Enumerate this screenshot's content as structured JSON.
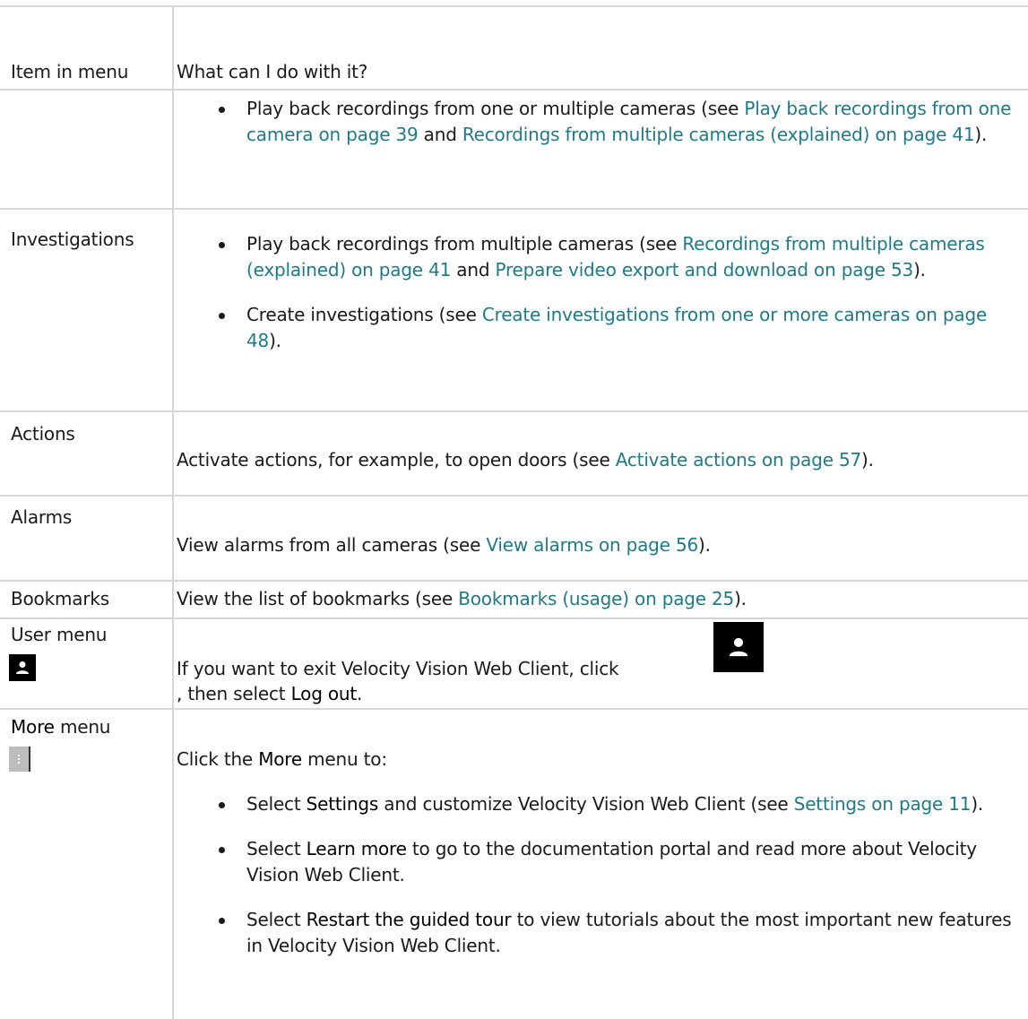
{
  "table": {
    "header": {
      "col1": "Item in menu",
      "col2": "What can I do with it?"
    },
    "rows": [
      {
        "label": "",
        "bullets": [
          [
            {
              "t": "Play back recordings from one or multiple cameras (see ",
              "k": "text"
            },
            {
              "t": "Play back recordings from one camera on page 39",
              "k": "link"
            },
            {
              "t": " and ",
              "k": "text"
            },
            {
              "t": "Recordings from multiple cameras (explained) on page 41",
              "k": "link"
            },
            {
              "t": ").",
              "k": "text"
            }
          ]
        ]
      },
      {
        "label": "Investigations",
        "bullets": [
          [
            {
              "t": "Play back recordings from multiple cameras (see ",
              "k": "text"
            },
            {
              "t": "Recordings from multiple cameras (explained) on page 41",
              "k": "link"
            },
            {
              "t": " and ",
              "k": "text"
            },
            {
              "t": "Prepare video export and download on page 53",
              "k": "link"
            },
            {
              "t": ").",
              "k": "text"
            }
          ],
          [
            {
              "t": "Create investigations (see ",
              "k": "text"
            },
            {
              "t": "Create investigations from one or more cameras on page 48",
              "k": "link"
            },
            {
              "t": ").",
              "k": "text"
            }
          ]
        ]
      },
      {
        "label": "Actions",
        "desc": [
          {
            "t": "Activate actions, for example, to open doors (see ",
            "k": "text"
          },
          {
            "t": "Activate actions on page 57",
            "k": "link"
          },
          {
            "t": ").",
            "k": "text"
          }
        ]
      },
      {
        "label": "Alarms",
        "desc": [
          {
            "t": "View alarms from all cameras (see ",
            "k": "text"
          },
          {
            "t": "View alarms on page 56",
            "k": "link"
          },
          {
            "t": ").",
            "k": "text"
          }
        ]
      },
      {
        "label": "Bookmarks",
        "desc": [
          {
            "t": "View the list of bookmarks (see ",
            "k": "text"
          },
          {
            "t": "Bookmarks (usage) on page 25",
            "k": "link"
          },
          {
            "t": ").",
            "k": "text"
          }
        ]
      },
      {
        "label": "User menu",
        "line1": "If you want to exit Velocity Vision Web Client, click ",
        "line2_pre": ", then select ",
        "line2_strong": "Log out",
        "line2_post": "."
      },
      {
        "label_strong": "More",
        "label_rest": " menu",
        "intro": [
          {
            "t": "Click the ",
            "k": "text"
          },
          {
            "t": "More",
            "k": "strong"
          },
          {
            "t": " menu to:",
            "k": "text"
          }
        ],
        "bullets": [
          [
            {
              "t": "Select ",
              "k": "text"
            },
            {
              "t": "Settings",
              "k": "strong"
            },
            {
              "t": " and customize Velocity Vision Web Client (see ",
              "k": "text"
            },
            {
              "t": "Settings on page 11",
              "k": "link"
            },
            {
              "t": ").",
              "k": "text"
            }
          ],
          [
            {
              "t": "Select ",
              "k": "text"
            },
            {
              "t": "Learn more",
              "k": "strong"
            },
            {
              "t": " to go to the documentation portal and read more about Velocity Vision Web Client.",
              "k": "text"
            }
          ],
          [
            {
              "t": "Select ",
              "k": "text"
            },
            {
              "t": "Restart the guided tour",
              "k": "strong"
            },
            {
              "t": " to view tutorials about the most important new features in Velocity Vision Web Client.",
              "k": "text"
            }
          ]
        ]
      }
    ]
  },
  "icons": {
    "user": "user-icon",
    "more": "more-vertical-icon"
  },
  "colors": {
    "link": "#1f7a86",
    "grid": "#d3d7db",
    "text": "#1a1a1a"
  }
}
